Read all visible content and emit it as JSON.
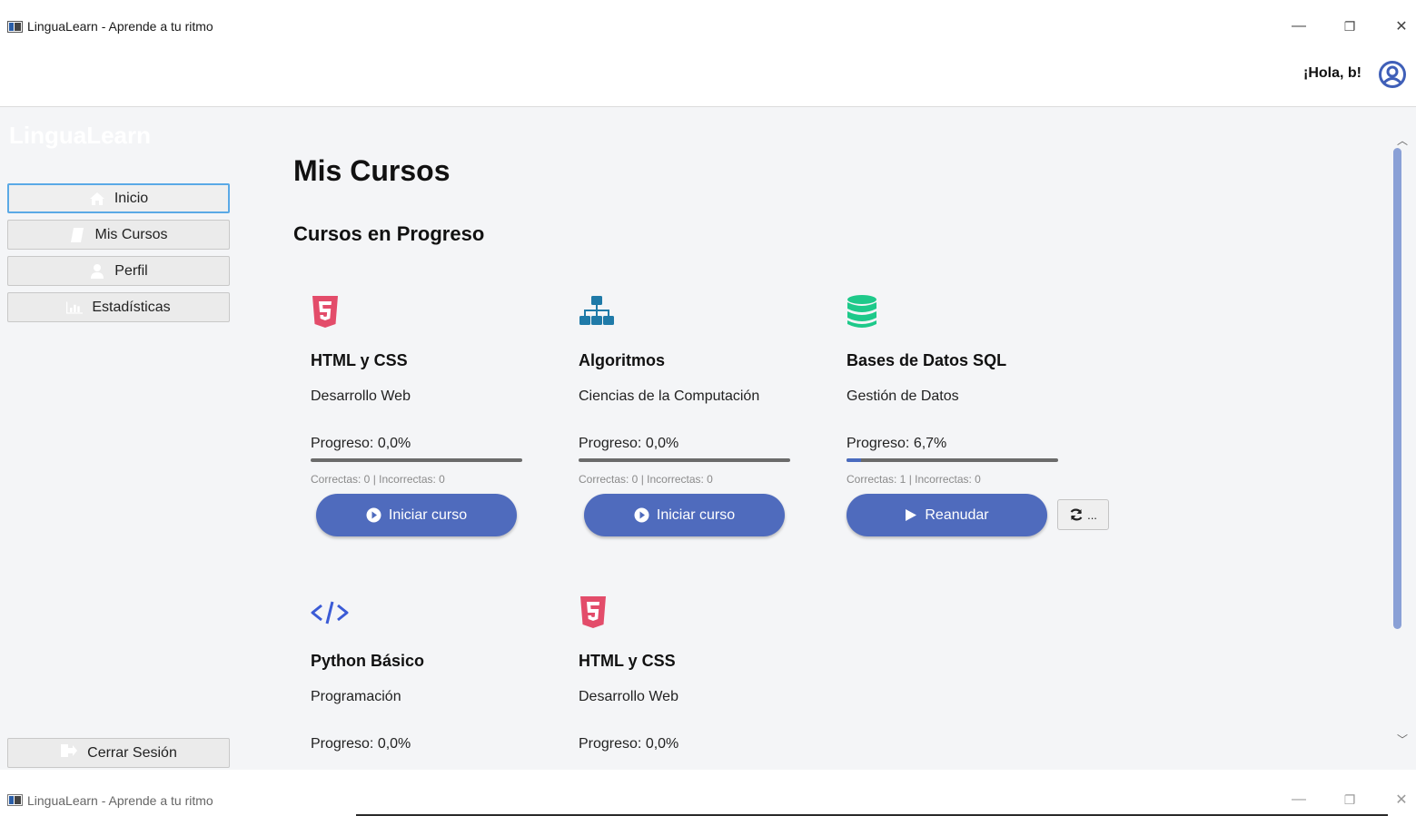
{
  "window": {
    "title": "LinguaLearn - Aprende a tu ritmo",
    "minimize": "—",
    "maximize": "❐",
    "close": "✕"
  },
  "header": {
    "greeting": "¡Hola, b!",
    "avatar_icon": "user-circle-icon"
  },
  "sidebar": {
    "brand": "LinguaLearn",
    "items": [
      {
        "label": "Inicio",
        "icon": "home-icon",
        "active": true
      },
      {
        "label": "Mis Cursos",
        "icon": "book-icon",
        "active": false
      },
      {
        "label": "Perfil",
        "icon": "user-icon",
        "active": false
      },
      {
        "label": "Estadísticas",
        "icon": "bar-chart-icon",
        "active": false
      }
    ],
    "logout": {
      "label": "Cerrar Sesión",
      "icon": "sign-out-icon"
    }
  },
  "main": {
    "title": "Mis Cursos",
    "section": "Cursos en Progreso",
    "courses": [
      {
        "name": "HTML y CSS",
        "category": "Desarrollo Web",
        "progress_text": "Progreso: 0,0%",
        "progress": 0.0,
        "stats": "Correctas: 0 | Incorrectas: 0",
        "button": "Iniciar curso",
        "icon": "html5-icon",
        "color": "#e34c6a"
      },
      {
        "name": "Algoritmos",
        "category": "Ciencias de la Computación",
        "progress_text": "Progreso: 0,0%",
        "progress": 0.0,
        "stats": "Correctas: 0 | Incorrectas: 0",
        "button": "Iniciar curso",
        "icon": "sitemap-icon",
        "color": "#1f7aa8"
      },
      {
        "name": "Bases de Datos SQL",
        "category": "Gestión de Datos",
        "progress_text": "Progreso: 6,7%",
        "progress": 0.067,
        "stats": "Correctas: 1 | Incorrectas: 0",
        "button": "Reanudar",
        "icon": "database-icon",
        "color": "#1ec98a",
        "reset_label": "..."
      },
      {
        "name": "Python Básico",
        "category": "Programación",
        "progress_text": "Progreso: 0,0%",
        "icon": "code-icon",
        "color": "#3b5bd6"
      },
      {
        "name": "HTML y CSS",
        "category": "Desarrollo Web",
        "progress_text": "Progreso: 0,0%",
        "icon": "html5-icon",
        "color": "#e34c6a"
      }
    ]
  },
  "taskbar": {
    "title": "LinguaLearn - Aprende a tu ritmo"
  }
}
